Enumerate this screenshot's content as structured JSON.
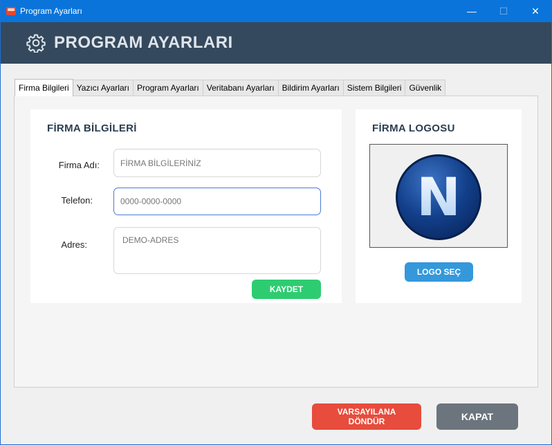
{
  "window": {
    "title": "Program Ayarları",
    "controls": {
      "minimize": "—",
      "maximize": "☐",
      "close": "✕"
    }
  },
  "header": {
    "icon": "gear-icon",
    "title": "PROGRAM AYARLARI"
  },
  "tabs": [
    {
      "label": "Firma Bilgileri",
      "active": true
    },
    {
      "label": "Yazıcı Ayarları",
      "active": false
    },
    {
      "label": "Program Ayarları",
      "active": false
    },
    {
      "label": "Veritabanı Ayarları",
      "active": false
    },
    {
      "label": "Bildirim Ayarları",
      "active": false
    },
    {
      "label": "Sistem Bilgileri",
      "active": false
    },
    {
      "label": "Güvenlik",
      "active": false
    }
  ],
  "company_info": {
    "title": "FİRMA BİLGİLERİ",
    "name_label": "Firma Adı:",
    "name_value": "FİRMA BİLGİLERİNİZ",
    "phone_label": "Telefon:",
    "phone_value": "0000-0000-0000",
    "address_label": "Adres:",
    "address_value": "DEMO-ADRES",
    "save_label": "KAYDET"
  },
  "company_logo": {
    "title": "FİRMA LOGOSU",
    "logo_letter": "N",
    "select_label": "LOGO SEÇ"
  },
  "footer": {
    "reset_label_line1": "VARSAYILANA",
    "reset_label_line2": "DÖNDÜR",
    "close_label": "KAPAT"
  },
  "colors": {
    "titlebar": "#0a74da",
    "header": "#34495e",
    "save": "#2ecc71",
    "logo_select": "#3498db",
    "reset": "#e74c3c",
    "close": "#6c757d"
  }
}
